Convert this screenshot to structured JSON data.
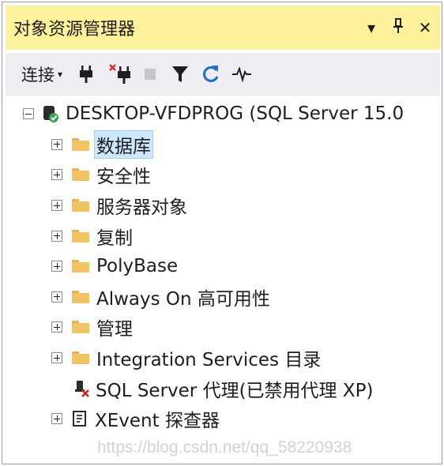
{
  "panel": {
    "title": "对象资源管理器",
    "dropdown_glyph": "▾",
    "pin_glyph": "⊥",
    "close_glyph": "✕"
  },
  "toolbar": {
    "connect_label": "连接",
    "caret_glyph": "▾"
  },
  "tree": {
    "server": {
      "label": "DESKTOP-VFDPROG (SQL Server 15.0"
    },
    "nodes": [
      {
        "label": "数据库",
        "selected": true
      },
      {
        "label": "安全性"
      },
      {
        "label": "服务器对象"
      },
      {
        "label": "复制"
      },
      {
        "label": "PolyBase"
      },
      {
        "label": "Always On 高可用性"
      },
      {
        "label": "管理"
      },
      {
        "label": "Integration Services 目录"
      },
      {
        "label": "SQL Server 代理(已禁用代理 XP)"
      },
      {
        "label": "XEvent 探查器"
      }
    ]
  },
  "watermark": "https://blog.csdn.net/qq_58220938",
  "colors": {
    "title_bar_bg": "#fff29d",
    "toolbar_bg": "#eeeef2",
    "selection_bg": "#cce8ff",
    "folder": "#f2c463",
    "refresh": "#1e73c8",
    "disconnect_x": "#e21b1b"
  }
}
